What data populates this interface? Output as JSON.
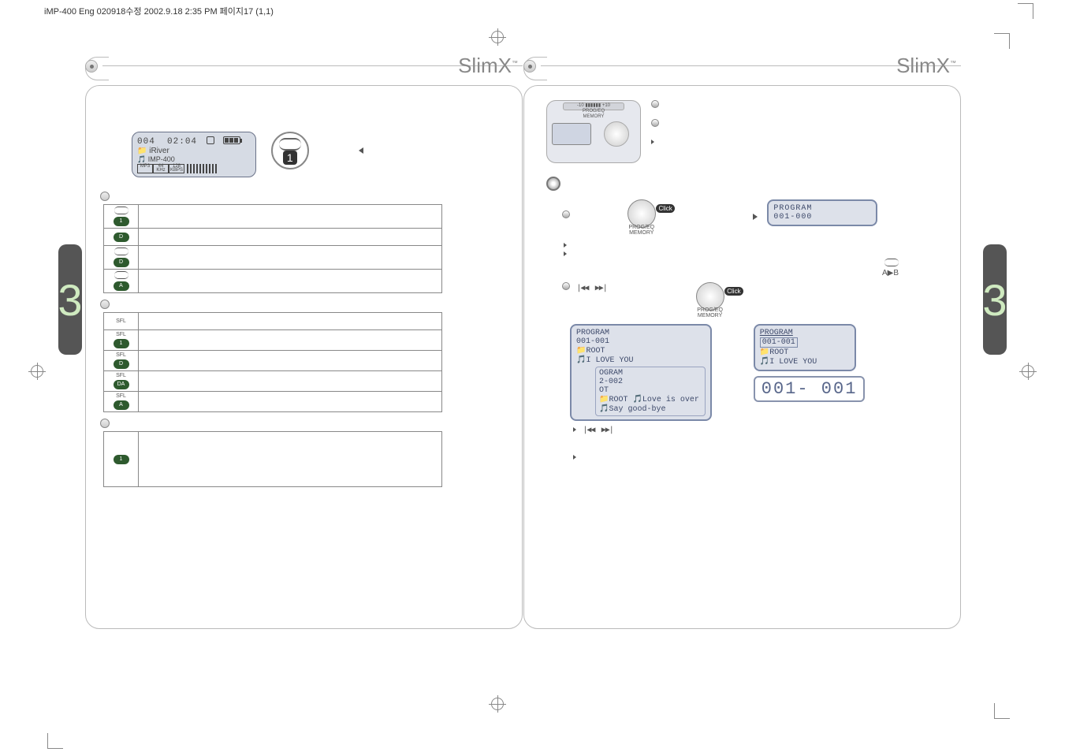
{
  "doc_header": "iMP-400 Eng 020918수정  2002.9.18 2:35 PM  페이지17 (1,1)",
  "brand": {
    "name": "SlimX",
    "tm": "™"
  },
  "left": {
    "lcd": {
      "track": "004",
      "time": "02:04",
      "folder_label": "iRiver",
      "model": "IMP-400",
      "mp3": "MP3",
      "khz": "44 KHz",
      "kbps": "128 KBPS"
    },
    "repeat_badge": "1",
    "mode_rows": {
      "r1": "1",
      "r2": "D",
      "r3": "D",
      "r4": "A"
    },
    "sfl": {
      "label": "SFL",
      "s1": "1",
      "s2": "D",
      "s3": "DA",
      "s4": "A"
    },
    "intro_row": "1"
  },
  "right": {
    "strip": {
      "minus": "-10",
      "plus": "+10",
      "l1": "PROG/EQ",
      "l2": "MEMORY"
    },
    "knob": {
      "click": "Click",
      "l1": "PROG/EQ",
      "l2": "MEMORY"
    },
    "lcd_a": {
      "title": "PROGRAM",
      "num": "001-000"
    },
    "ab_repeat": "A▶B",
    "lcd_b": {
      "title": "PROGRAM",
      "num": "001-001",
      "folder": "ROOT",
      "song": "I LOVE YOU",
      "sub_num": "2-002",
      "sub_title": "OGRAM",
      "sub_ot": "OT",
      "sub_folder": "ROOT",
      "sub_song1": "Love is over",
      "sub_song2": "Say good-bye"
    },
    "lcd_c": {
      "title": "PROGRAM",
      "num": "001-001",
      "folder": "ROOT",
      "song": "I LOVE YOU"
    },
    "zoom": "001- 001"
  }
}
